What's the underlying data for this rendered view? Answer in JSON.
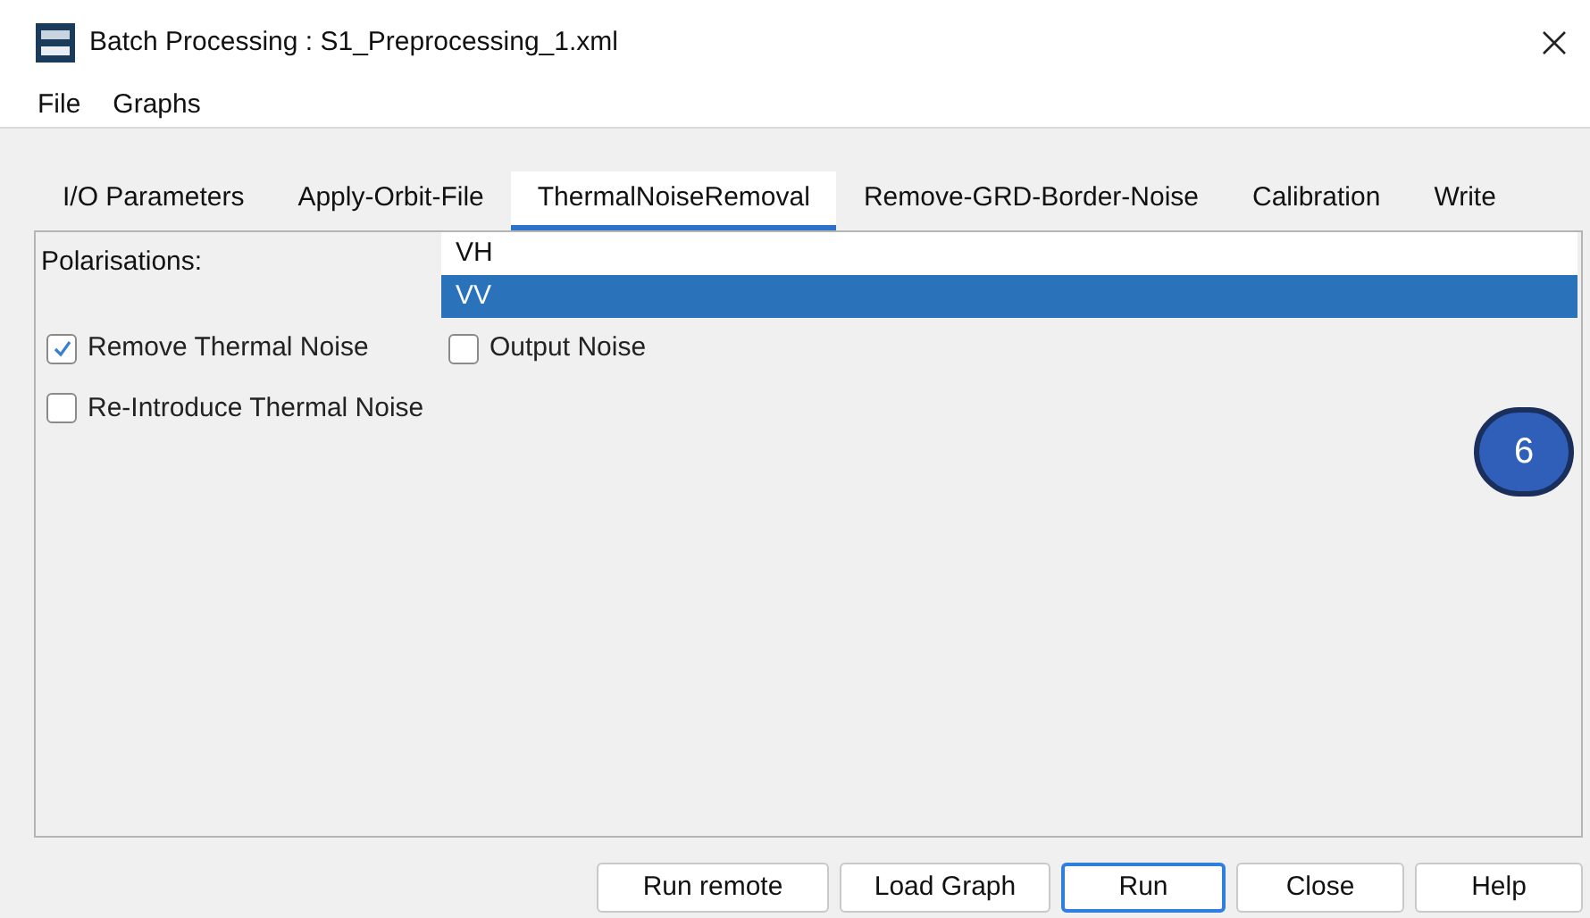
{
  "window": {
    "title": "Batch Processing : S1_Preprocessing_1.xml"
  },
  "menu": [
    "File",
    "Graphs"
  ],
  "tabs": [
    {
      "label": "I/O Parameters",
      "selected": false
    },
    {
      "label": "Apply-Orbit-File",
      "selected": false
    },
    {
      "label": "ThermalNoiseRemoval",
      "selected": true
    },
    {
      "label": "Remove-GRD-Border-Noise",
      "selected": false
    },
    {
      "label": "Calibration",
      "selected": false
    },
    {
      "label": "Write",
      "selected": false
    }
  ],
  "polarisations": {
    "label": "Polarisations:",
    "items": [
      {
        "label": "VH",
        "selected": false
      },
      {
        "label": "VV",
        "selected": true
      }
    ]
  },
  "checkboxes": [
    [
      {
        "label": "Remove Thermal Noise",
        "checked": true
      },
      {
        "label": "Output Noise",
        "checked": false
      }
    ],
    [
      {
        "label": "Re-Introduce Thermal Noise",
        "checked": false
      }
    ]
  ],
  "callout": "6",
  "buttons": [
    {
      "label": "Run remote",
      "focused": false
    },
    {
      "label": "Load Graph",
      "focused": false
    },
    {
      "label": "Run",
      "focused": true
    },
    {
      "label": "Close",
      "focused": false
    },
    {
      "label": "Help",
      "focused": false
    }
  ]
}
